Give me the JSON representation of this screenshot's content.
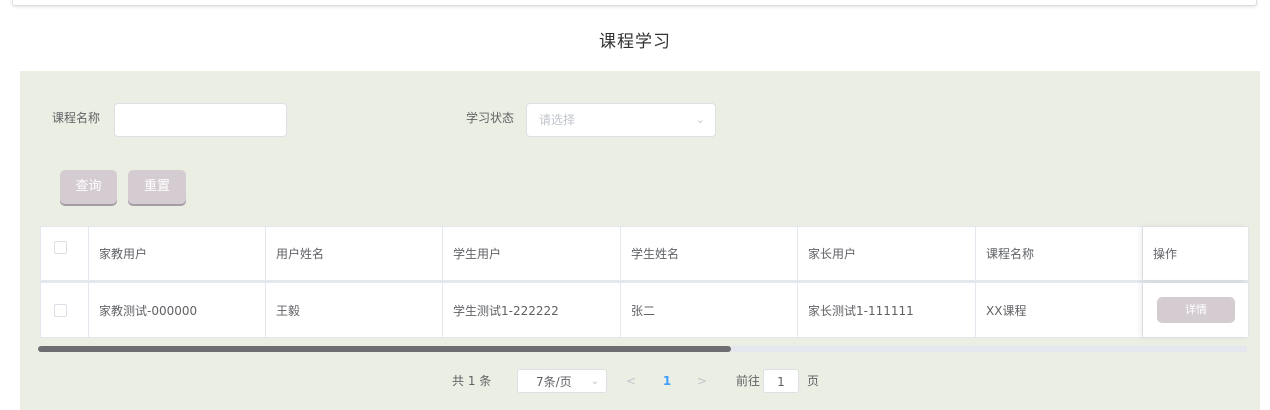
{
  "header": {
    "title": "课程学习"
  },
  "filters": {
    "course_name_label": "课程名称",
    "course_name_value": "",
    "status_label": "学习状态",
    "status_placeholder": "请选择"
  },
  "buttons": {
    "search": "查询",
    "reset": "重置"
  },
  "table": {
    "columns": [
      "家教用户",
      "用户姓名",
      "学生用户",
      "学生姓名",
      "家长用户",
      "课程名称",
      "操作"
    ],
    "rows": [
      {
        "tutor_user": "家教测试-000000",
        "user_name": "王毅",
        "student_user": "学生测试1-222222",
        "student_name": "张二",
        "parent_user": "家长测试1-111111",
        "course_name": "XX课程",
        "action": "详情"
      }
    ]
  },
  "pagination": {
    "total": "共 1 条",
    "page_size": "7条/页",
    "current_page": "1",
    "goto_label": "前往",
    "goto_value": "1",
    "page_suffix": "页"
  },
  "colors": {
    "panel_bg": "#ebefe3",
    "button_bg": "#d5ccd2",
    "active_page": "#409eff"
  }
}
